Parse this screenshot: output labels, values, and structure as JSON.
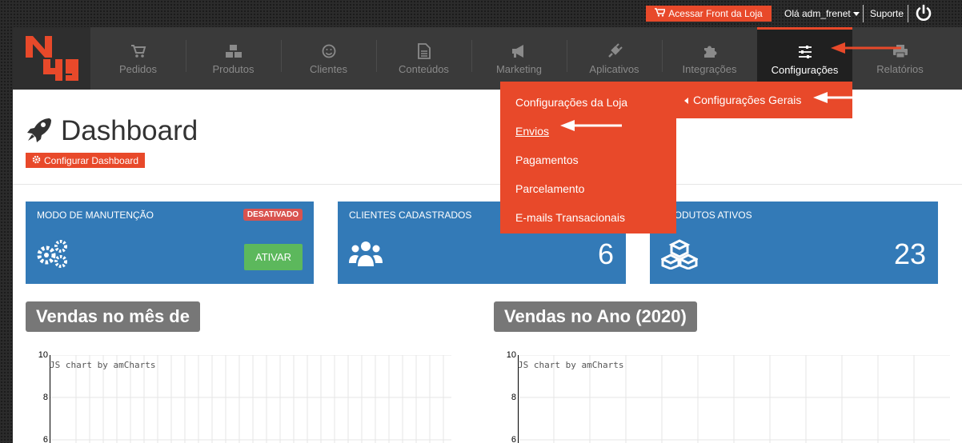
{
  "topbar": {
    "store_button": "Acessar Front da Loja",
    "user_greeting": "Olá adm_frenet",
    "support": "Suporte"
  },
  "nav": {
    "logo": "N49",
    "items": [
      {
        "label": "Pedidos",
        "icon": "cart-icon"
      },
      {
        "label": "Produtos",
        "icon": "boxes-icon"
      },
      {
        "label": "Clientes",
        "icon": "smile-icon"
      },
      {
        "label": "Conteúdos",
        "icon": "document-icon"
      },
      {
        "label": "Marketing",
        "icon": "megaphone-icon"
      },
      {
        "label": "Aplicativos",
        "icon": "plug-icon"
      },
      {
        "label": "Integrações",
        "icon": "puzzle-icon"
      },
      {
        "label": "Configurações",
        "icon": "sliders-icon"
      },
      {
        "label": "Relatórios",
        "icon": "printer-icon"
      }
    ]
  },
  "dropdown": {
    "items": [
      "Configurações da Loja",
      "Envios",
      "Pagamentos",
      "Parcelamento",
      "E-mails Transacionais"
    ],
    "submenu": "Configurações Gerais"
  },
  "page": {
    "title": "Dashboard",
    "config_button": "Configurar Dashboard"
  },
  "cards": {
    "maintenance": {
      "label": "MODO DE MANUTENÇÃO",
      "badge": "DESATIVADO",
      "button": "ATIVAR"
    },
    "clients": {
      "label": "CLIENTES CADASTRADOS",
      "value": "6"
    },
    "products": {
      "label": "PRODUTOS ATIVOS",
      "value": "23"
    }
  },
  "charts": {
    "month_title": "Vendas no mês de",
    "year_title": "Vendas no Ano (2020)",
    "credit": "JS chart by amCharts",
    "yticks": [
      "10",
      "8",
      "6"
    ]
  },
  "colors": {
    "accent": "#e8492a",
    "card": "#337ab7",
    "nav": "#3a3a3a",
    "success": "#5cb85c",
    "danger": "#d9534f"
  }
}
